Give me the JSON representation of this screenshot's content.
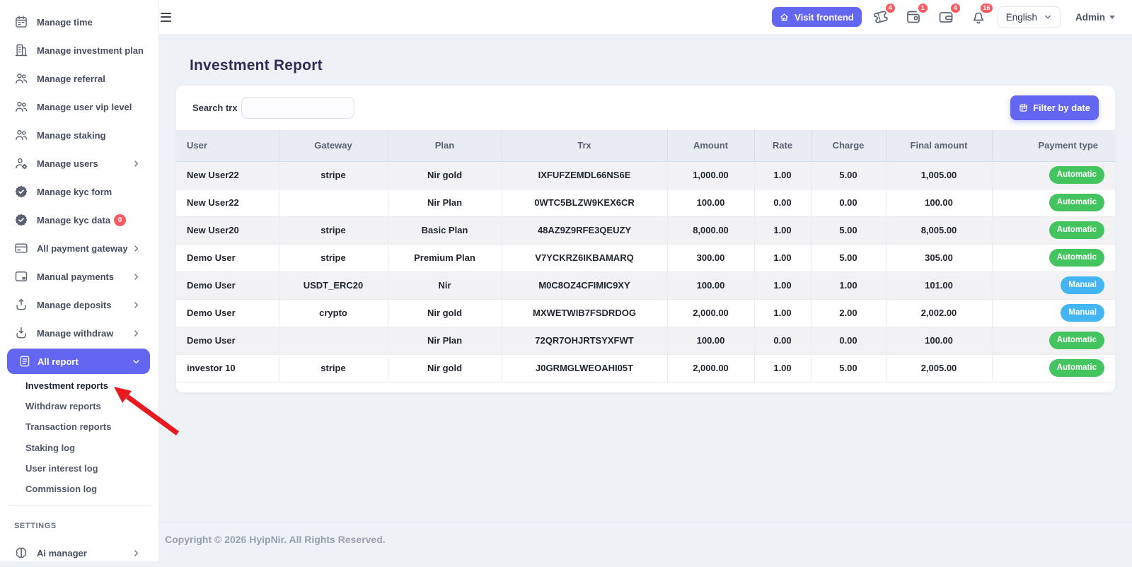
{
  "colors": {
    "accent": "#6366f1",
    "badge_green": "#44c45e",
    "badge_blue": "#43b5f3",
    "badge_red": "#fa5a60",
    "arrow_red": "#e8191f"
  },
  "sidebar": {
    "items": [
      {
        "label": "Manage time",
        "icon": "calendar"
      },
      {
        "label": "Manage investment plan",
        "icon": "building"
      },
      {
        "label": "Manage referral",
        "icon": "users"
      },
      {
        "label": "Manage user vip level",
        "icon": "users"
      },
      {
        "label": "Manage staking",
        "icon": "users"
      },
      {
        "label": "Manage users",
        "icon": "user-gear",
        "chevron": true
      },
      {
        "label": "Manage kyc form",
        "icon": "badge-check"
      },
      {
        "label": "Manage kyc data",
        "icon": "badge-check",
        "badge": "0"
      },
      {
        "label": "All payment gateway",
        "icon": "credit-card",
        "chevron": true
      },
      {
        "label": "Manual payments",
        "icon": "manual-payment",
        "chevron": true
      },
      {
        "label": "Manage deposits",
        "icon": "deposit",
        "chevron": true
      },
      {
        "label": "Manage withdraw",
        "icon": "withdraw",
        "chevron": true
      },
      {
        "label": "All report",
        "icon": "report",
        "chevron": true,
        "expanded": true,
        "active": true
      }
    ],
    "report_subitems": [
      {
        "label": "Investment reports",
        "active": true
      },
      {
        "label": "Withdraw reports"
      },
      {
        "label": "Transaction reports"
      },
      {
        "label": "Staking log"
      },
      {
        "label": "User interest log"
      },
      {
        "label": "Commission log"
      }
    ],
    "section_label": "SETTINGS",
    "settings_items": [
      {
        "label": "Ai manager",
        "icon": "brain",
        "chevron": true
      }
    ]
  },
  "topbar": {
    "visit_frontend_label": "Visit frontend",
    "icon_badges": [
      {
        "icon": "ticket",
        "count": "4"
      },
      {
        "icon": "wallet-coin",
        "count": "1"
      },
      {
        "icon": "wallet",
        "count": "4"
      },
      {
        "icon": "bell",
        "count": "16"
      }
    ],
    "language": "English",
    "user_label": "Admin"
  },
  "page": {
    "title": "Investment Report"
  },
  "filters": {
    "search_label": "Search trx",
    "search_value": "",
    "filter_button_label": "Filter by date"
  },
  "table": {
    "columns": [
      "User",
      "Gateway",
      "Plan",
      "Trx",
      "Amount",
      "Rate",
      "Charge",
      "Final amount",
      "Payment type"
    ],
    "rows": [
      {
        "user": "New User22",
        "gateway": "stripe",
        "plan": "Nir gold",
        "trx": "IXFUFZEMDL66NS6E",
        "amount": "1,000.00",
        "rate": "1.00",
        "charge": "5.00",
        "final_amount": "1,005.00",
        "payment_type": "Automatic"
      },
      {
        "user": "New User22",
        "gateway": "",
        "plan": "Nir Plan",
        "trx": "0WTC5BLZW9KEX6CR",
        "amount": "100.00",
        "rate": "0.00",
        "charge": "0.00",
        "final_amount": "100.00",
        "payment_type": "Automatic"
      },
      {
        "user": "New User20",
        "gateway": "stripe",
        "plan": "Basic Plan",
        "trx": "48AZ9Z9RFE3QEUZY",
        "amount": "8,000.00",
        "rate": "1.00",
        "charge": "5.00",
        "final_amount": "8,005.00",
        "payment_type": "Automatic"
      },
      {
        "user": "Demo User",
        "gateway": "stripe",
        "plan": "Premium Plan",
        "trx": "V7YCKRZ6IKBAMARQ",
        "amount": "300.00",
        "rate": "1.00",
        "charge": "5.00",
        "final_amount": "305.00",
        "payment_type": "Automatic"
      },
      {
        "user": "Demo User",
        "gateway": "USDT_ERC20",
        "plan": "Nir",
        "trx": "M0C8OZ4CFIMIC9XY",
        "amount": "100.00",
        "rate": "1.00",
        "charge": "1.00",
        "final_amount": "101.00",
        "payment_type": "Manual"
      },
      {
        "user": "Demo User",
        "gateway": "crypto",
        "plan": "Nir gold",
        "trx": "MXWETWIB7FSDRDOG",
        "amount": "2,000.00",
        "rate": "1.00",
        "charge": "2.00",
        "final_amount": "2,002.00",
        "payment_type": "Manual"
      },
      {
        "user": "Demo User",
        "gateway": "",
        "plan": "Nir Plan",
        "trx": "72QR7OHJRTSYXFWT",
        "amount": "100.00",
        "rate": "0.00",
        "charge": "0.00",
        "final_amount": "100.00",
        "payment_type": "Automatic"
      },
      {
        "user": "investor 10",
        "gateway": "stripe",
        "plan": "Nir gold",
        "trx": "J0GRMGLWEOAHI05T",
        "amount": "2,000.00",
        "rate": "1.00",
        "charge": "5.00",
        "final_amount": "2,005.00",
        "payment_type": "Automatic"
      }
    ]
  },
  "footer": {
    "copyright": "Copyright © 2026 HyipNir. All Rights Reserved."
  }
}
